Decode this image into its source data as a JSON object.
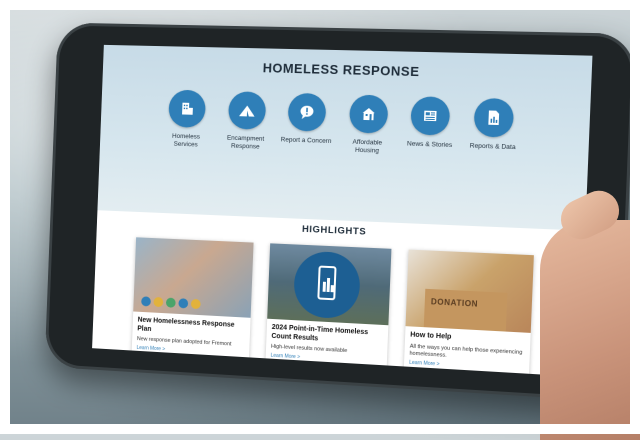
{
  "page": {
    "title": "HOMELESS RESPONSE"
  },
  "nav": [
    {
      "label": "Homeless Services",
      "icon": "building-icon"
    },
    {
      "label": "Encampment Response",
      "icon": "tent-icon"
    },
    {
      "label": "Report a Concern",
      "icon": "speech-bubble-icon"
    },
    {
      "label": "Affordable Housing",
      "icon": "house-icon"
    },
    {
      "label": "News & Stories",
      "icon": "newspaper-icon"
    },
    {
      "label": "Reports & Data",
      "icon": "document-icon"
    }
  ],
  "highlights": {
    "heading": "HIGHLIGHTS",
    "cards": [
      {
        "title": "New Homelessness Response Plan",
        "desc": "New response plan adopted for Fremont",
        "link": "Learn More >"
      },
      {
        "title": "2024 Point-in-Time Homeless Count Results",
        "desc": "High-level results now available",
        "link": "Learn More >"
      },
      {
        "title": "How to Help",
        "desc": "All the ways you can help those experiencing homelessness.",
        "link": "Learn More >"
      }
    ],
    "donation_label": "DONATION"
  },
  "colors": {
    "accent": "#2f7fb8",
    "title": "#1f2d3a"
  }
}
